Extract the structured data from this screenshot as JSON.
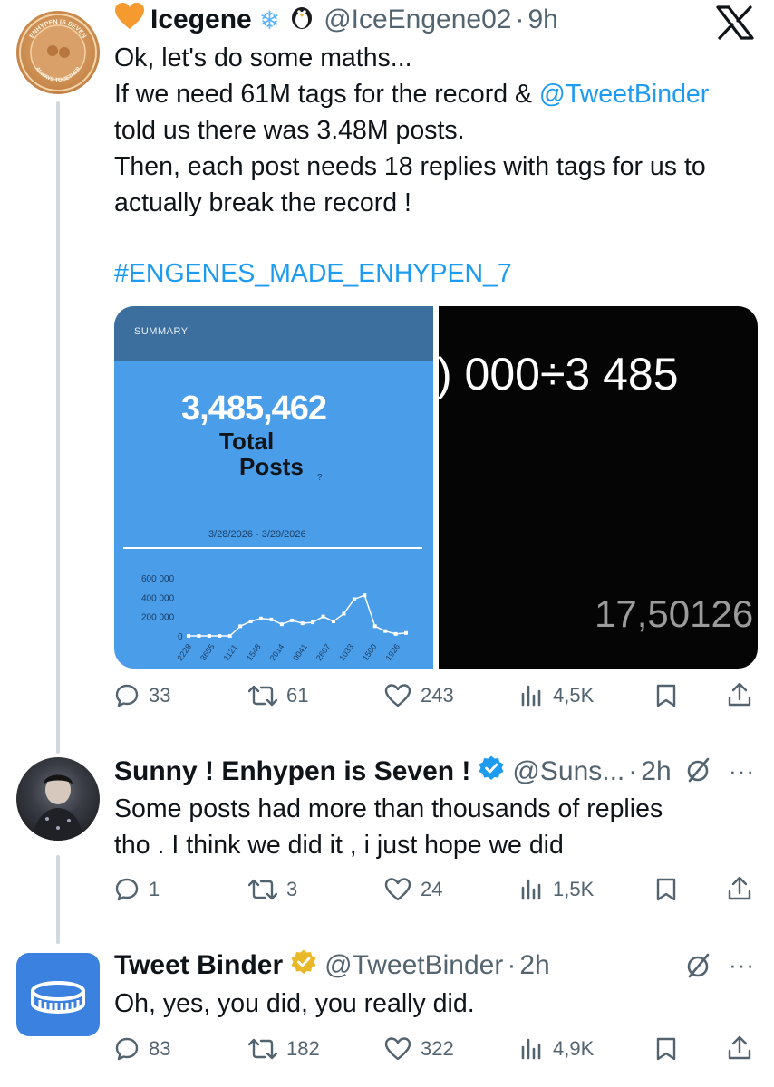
{
  "tweet1": {
    "display_name": "Icegene",
    "handle": "@IceEngene02",
    "time": "9h",
    "text_lines": [
      "Ok, let's do some maths...",
      "If we need 61M tags for the record & ",
      "told us there was 3.48M posts.",
      "Then, each post needs 18 replies with tags for us to",
      "actually break the record !"
    ],
    "mention": "@TweetBinder",
    "hashtag": "#ENGENES_MADE_ENHYPEN_7",
    "avatar_text_top": "ENHYPEN IS SEVEN",
    "avatar_text_bottom": "ALWAYS TOGETHER",
    "media_left": {
      "header": "SUMMARY",
      "total": "3,485,462",
      "label1": "Total",
      "label2": "Posts",
      "help": "?",
      "date_range": "3/28/2026 - 3/29/2026",
      "chart_data": {
        "type": "line",
        "x": [
          "2228",
          "3655",
          "1121",
          "1548",
          "2014",
          "0041",
          "2607",
          "1033",
          "1500",
          "1926"
        ],
        "values": [
          0,
          0,
          0,
          0,
          0,
          100000,
          150000,
          180000,
          170000,
          120000,
          160000,
          130000,
          140000,
          200000,
          150000,
          230000,
          380000,
          420000,
          100000,
          50000,
          20000,
          30000
        ],
        "yticks": [
          "600 000",
          "400 000",
          "200 000",
          "0"
        ],
        "ylim": [
          0,
          600000
        ]
      }
    },
    "media_right": {
      "top_text": ") 000÷3 485",
      "bottom_text": "17,50126"
    },
    "stats": {
      "replies": "33",
      "reposts": "61",
      "likes": "243",
      "views": "4,5K"
    }
  },
  "tweet2": {
    "display_name": "Sunny ! Enhypen is Seven !",
    "handle": "@Suns...",
    "time": "2h",
    "text_lines": [
      "Some posts had more than thousands of replies",
      "tho . I think we did it , i just hope we did"
    ],
    "stats": {
      "replies": "1",
      "reposts": "3",
      "likes": "24",
      "views": "1,5K"
    }
  },
  "tweet3": {
    "display_name": "Tweet Binder",
    "handle": "@TweetBinder",
    "time": "2h",
    "text_lines": [
      "Oh, yes, you did, you really did."
    ],
    "stats": {
      "replies": "83",
      "reposts": "182",
      "likes": "322",
      "views": "4,9K"
    }
  },
  "colors": {
    "accent": "#1d9bf0",
    "secondary_text": "#536471",
    "verified_blue": "#1d9bf0",
    "verified_gold": "#e8b829",
    "chart_blue": "#4a9de8",
    "tweetbinder_blue": "#3b82e0"
  },
  "icons": {
    "x_logo": "x-logo-icon",
    "heart_emoji": "orange-heart-icon",
    "snowflake": "snowflake-icon",
    "penguin": "penguin-icon"
  },
  "more_label": "···"
}
